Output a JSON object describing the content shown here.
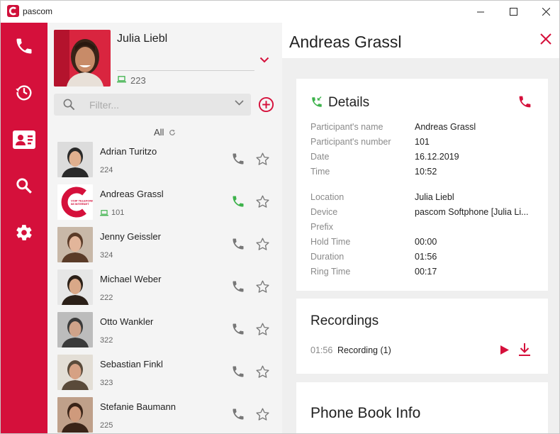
{
  "window": {
    "app_title": "pascom",
    "controls": {
      "minimize": "minimize-icon",
      "maximize": "maximize-icon",
      "close": "close-icon"
    }
  },
  "theme": {
    "brand_red": "#d5103b",
    "green": "#3db24b",
    "grey_icon": "#777777"
  },
  "rail": {
    "items": [
      {
        "name": "phone",
        "icon": "phone-icon"
      },
      {
        "name": "history",
        "icon": "history-icon"
      },
      {
        "name": "contacts",
        "icon": "contact-card-icon"
      },
      {
        "name": "search",
        "icon": "search-icon"
      },
      {
        "name": "settings",
        "icon": "gear-icon"
      }
    ]
  },
  "profile": {
    "name": "Julia Liebl",
    "extension": "223"
  },
  "filter": {
    "placeholder": "Filter..."
  },
  "list": {
    "header": "All"
  },
  "contacts": [
    {
      "name": "Adrian Turitzo",
      "extension": "224",
      "device_icon": false
    },
    {
      "name": "Andreas Grassl",
      "extension": "101",
      "device_icon": true
    },
    {
      "name": "Jenny Geissler",
      "extension": "324",
      "device_icon": false
    },
    {
      "name": "Michael Weber",
      "extension": "222",
      "device_icon": false
    },
    {
      "name": "Otto Wankler",
      "extension": "322",
      "device_icon": false
    },
    {
      "name": "Sebastian Finkl",
      "extension": "323",
      "device_icon": false
    },
    {
      "name": "Stefanie Baumann",
      "extension": "225",
      "device_icon": false
    }
  ],
  "detail": {
    "title": "Andreas Grassl",
    "details_title": "Details",
    "rows": [
      {
        "label": "Participant's name",
        "value": "Andreas Grassl"
      },
      {
        "label": "Participant's number",
        "value": "101"
      },
      {
        "label": "Date",
        "value": "16.12.2019"
      },
      {
        "label": "Time",
        "value": "10:52"
      },
      {
        "label": "Location",
        "value": "Julia Liebl"
      },
      {
        "label": "Device",
        "value": "pascom Softphone [Julia Li..."
      },
      {
        "label": "Prefix",
        "value": ""
      },
      {
        "label": "Hold Time",
        "value": "00:00"
      },
      {
        "label": "Duration",
        "value": "01:56"
      },
      {
        "label": "Ring Time",
        "value": "00:17"
      }
    ],
    "recordings_title": "Recordings",
    "recording": {
      "duration": "01:56",
      "name": "Recording (1)"
    },
    "phonebook_title": "Phone Book Info"
  }
}
